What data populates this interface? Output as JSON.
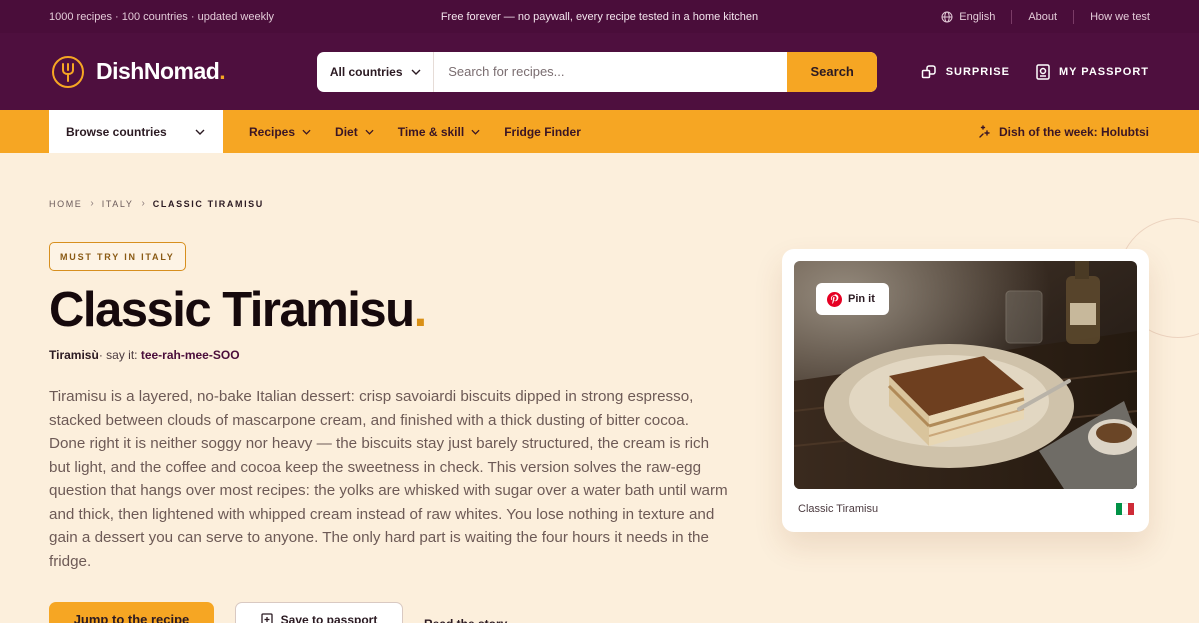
{
  "topbar": {
    "stats": "1000 recipes · 100 countries · updated weekly",
    "tagline": "Free forever — no paywall, every recipe tested in a home kitchen",
    "language": "English",
    "about": "About",
    "how_we_test": "How we test"
  },
  "header": {
    "brand": "DishNomad",
    "brand_dot": ".",
    "search": {
      "country_select": "All countries",
      "placeholder": "Search for recipes...",
      "button": "Search"
    },
    "surprise": "SURPRISE",
    "passport": "MY PASSPORT"
  },
  "nav": {
    "browse": "Browse countries",
    "links": [
      "Recipes",
      "Diet",
      "Time & skill",
      "Fridge Finder"
    ],
    "dish_of_week": "Dish of the week: Holubtsi"
  },
  "breadcrumb": [
    "HOME",
    "ITALY",
    "CLASSIC TIRAMISU"
  ],
  "recipe": {
    "badge": "MUST TRY IN ITALY",
    "title": "Classic Tiramisu",
    "title_dot": ".",
    "native_name": "Tiramisù",
    "say_it_label": "· say it:",
    "pronunciation": "tee-rah-mee-SOO",
    "description": "Tiramisu is a layered, no-bake Italian dessert: crisp savoiardi biscuits dipped in strong espresso, stacked between clouds of mascarpone cream, and finished with a thick dusting of bitter cocoa. Done right it is neither soggy nor heavy — the biscuits stay just barely structured, the cream is rich but light, and the coffee and cocoa keep the sweetness in check. This version solves the raw-egg question that hangs over most recipes: the yolks are whisked with sugar over a water bath until warm and thick, then lightened with whipped cream instead of raw whites. You lose nothing in texture and gain a dessert you can serve to anyone. The only hard part is waiting the four hours it needs in the fridge."
  },
  "actions": {
    "jump": "Jump to the recipe",
    "save": "Save to passport",
    "story": "Read the story"
  },
  "card": {
    "pin": "Pin it",
    "caption": "Classic Tiramisu",
    "flag_colors": [
      "#009246",
      "#ffffff",
      "#ce2b37"
    ]
  },
  "colors": {
    "plum": "#4e0f3e",
    "accent": "#f6a623",
    "background": "#fcefdc"
  }
}
